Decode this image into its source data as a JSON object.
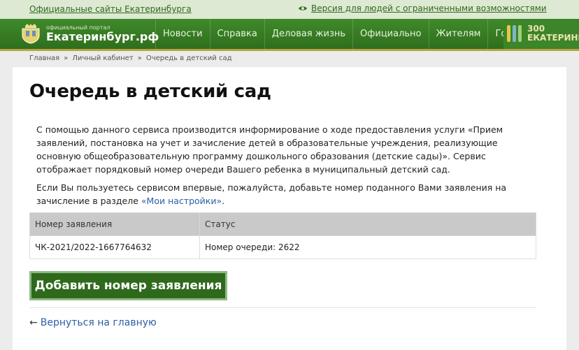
{
  "topbar": {
    "sites_link": "Официальные сайты Екатеринбурга",
    "accessibility_link": "Версия для людей с ограниченными возможностями"
  },
  "header": {
    "logo_small": "официальный портал",
    "logo_name": "Екатеринбург.рф",
    "menu": [
      "Новости",
      "Справка",
      "Деловая жизнь",
      "Официально",
      "Жителям",
      "Гостям"
    ],
    "partner_text_top": "300",
    "partner_text_bottom": "ЕКАТЕРИНБУ"
  },
  "breadcrumb": {
    "items": [
      "Главная",
      "Личный кабинет",
      "Очередь в детский сад"
    ],
    "separator": "»"
  },
  "page": {
    "title": "Очередь в детский сад",
    "intro": "С помощью данного сервиса производится информирование о ходе предоставления услуги «Прием заявлений, постановка на учет и зачисление детей в образовательные учреждения, реализующие основную общеобразовательную программу дошкольного образования (детские сады)». Сервис отображает порядковый номер очереди Вашего ребенка в муниципальный детский сад.",
    "note_before": "Если Вы пользуетесь сервисом впервые, пожалуйста, добавьте номер поданного Вами заявления на зачисление в разделе ",
    "note_link": "«Мои настройки»",
    "note_after": "."
  },
  "table": {
    "headers": [
      "Номер заявления",
      "Статус"
    ],
    "rows": [
      [
        "ЧК-2021/2022-1667764632",
        "Номер очереди: 2622"
      ]
    ]
  },
  "actions": {
    "add_button": "Добавить номер заявления",
    "back_arrow": "←",
    "back_link": "Вернуться на главную"
  },
  "colors": {
    "brand_green": "#2f6a1c",
    "link_blue": "#2b5fa6",
    "nav_accent": "#b8a440"
  }
}
